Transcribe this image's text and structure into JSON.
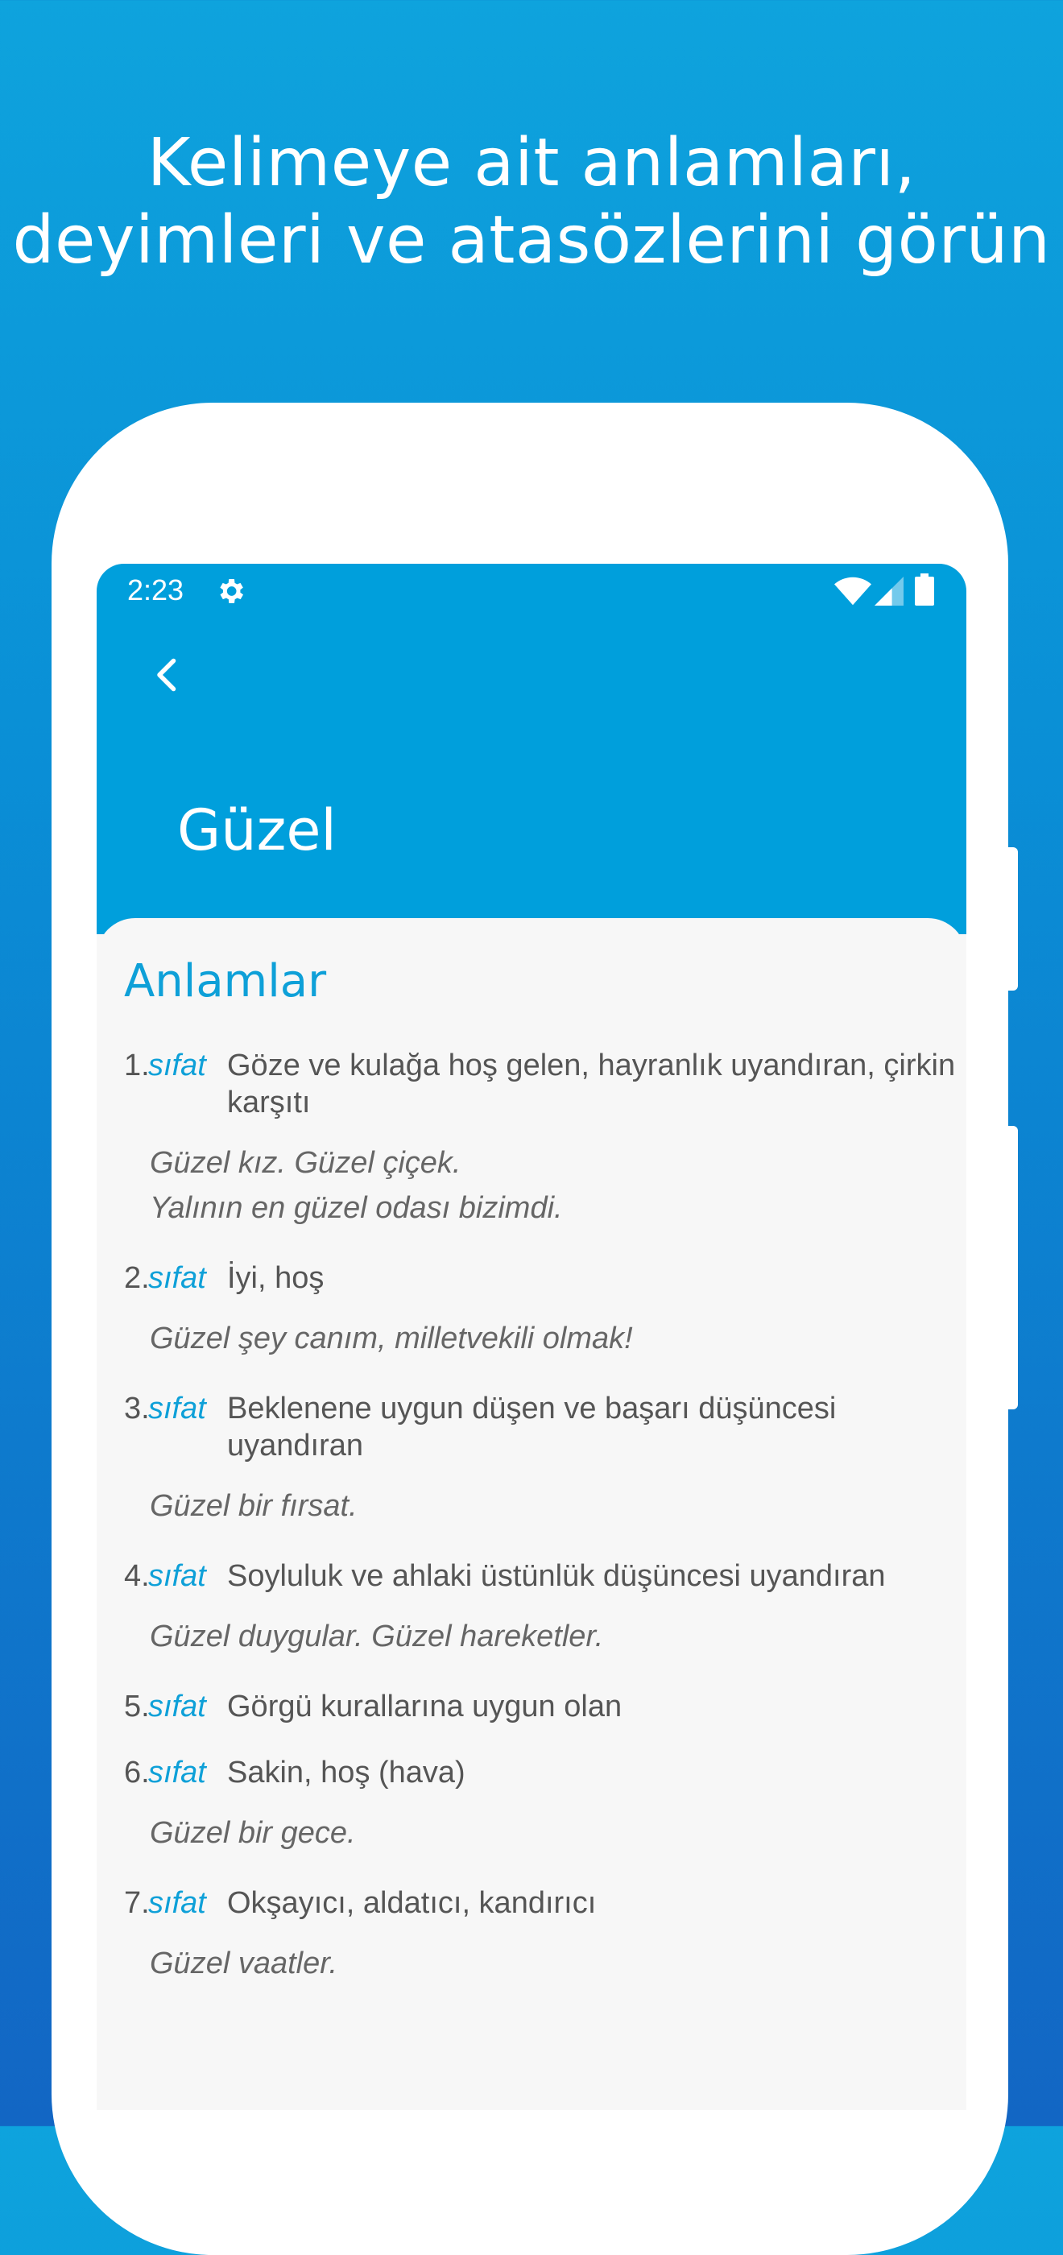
{
  "headline": {
    "line1": "Kelimeye ait anlamları,",
    "line2": "deyimleri ve atasözlerini görün"
  },
  "status_bar": {
    "time": "2:23",
    "icons": [
      "settings-gear-icon",
      "wifi-icon",
      "cell-signal-icon",
      "battery-icon"
    ]
  },
  "toolbar": {
    "back_icon": "chevron-left-icon"
  },
  "word": {
    "title": "Güzel"
  },
  "section": {
    "title": "Anlamlar"
  },
  "meanings": [
    {
      "num": "1.",
      "pos": "sıfat",
      "def": "Göze ve kulağa hoş gelen, hayranlık uyandıran, çirkin karşıtı",
      "examples": [
        "Güzel kız. Güzel çiçek.",
        "Yalının en güzel odası bizimdi."
      ]
    },
    {
      "num": "2.",
      "pos": "sıfat",
      "def": "İyi, hoş",
      "examples": [
        "Güzel şey canım, milletvekili olmak!"
      ]
    },
    {
      "num": "3.",
      "pos": "sıfat",
      "def": "Beklenene uygun düşen ve başarı düşüncesi uyandıran",
      "examples": [
        "Güzel bir fırsat."
      ]
    },
    {
      "num": "4.",
      "pos": "sıfat",
      "def": "Soyluluk ve ahlaki üstünlük düşüncesi uyandıran",
      "examples": [
        "Güzel duygular. Güzel hareketler."
      ]
    },
    {
      "num": "5.",
      "pos": "sıfat",
      "def": "Görgü kurallarına uygun olan",
      "examples": []
    },
    {
      "num": "6.",
      "pos": "sıfat",
      "def": "Sakin, hoş (hava)",
      "examples": [
        "Güzel bir gece."
      ]
    },
    {
      "num": "7.",
      "pos": "sıfat",
      "def": "Okşayıcı, aldatıcı, kandırıcı",
      "examples": [
        "Güzel vaatler."
      ]
    }
  ],
  "colors": {
    "accent": "#0ea0d8",
    "appbar": "#009fdc",
    "text": "#555555",
    "example_text": "#666666"
  }
}
